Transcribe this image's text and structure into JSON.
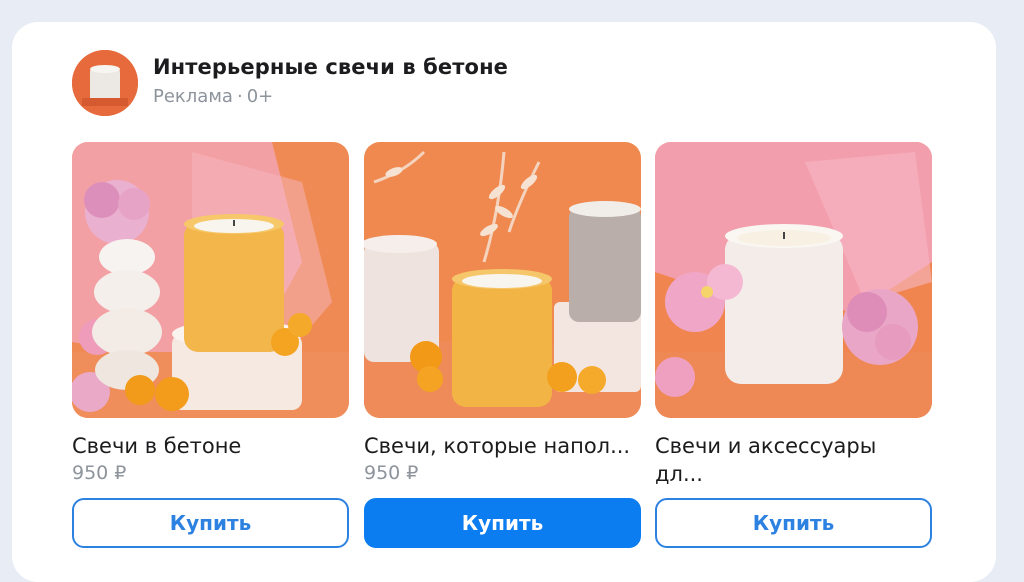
{
  "ad": {
    "title": "Интерьерные свечи в бетоне",
    "label": "Реклама",
    "separator": "·",
    "age_rating": "0+"
  },
  "products": [
    {
      "name": "Свечи в бетоне",
      "price": "950 ₽",
      "button": "Купить",
      "image": "candle-yellow-with-flowers"
    },
    {
      "name": "Свечи, которые напол...",
      "price": "950 ₽",
      "button": "Купить",
      "image": "candles-three-pots"
    },
    {
      "name": "Свечи и аксессуары дл...",
      "price": "",
      "button": "Купить",
      "image": "candle-white-with-pink-flowers"
    }
  ],
  "colors": {
    "accent": "#0b7df0",
    "outline": "#2d81e0",
    "background": "#e8edf5",
    "image_orange": "#f28a52"
  }
}
